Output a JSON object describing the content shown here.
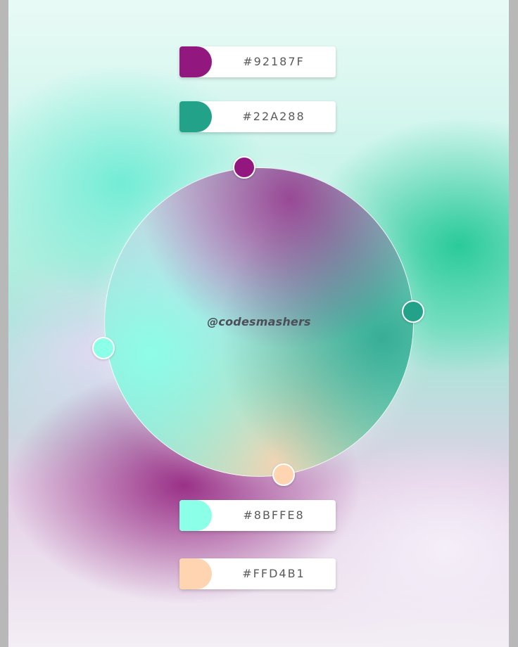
{
  "palette": [
    {
      "hex": "#92187F",
      "color": "#92187F"
    },
    {
      "hex": "#22A288",
      "color": "#22A288"
    },
    {
      "hex": "#8BFFE8",
      "color": "#8BFFE8"
    },
    {
      "hex": "#FFD4B1",
      "color": "#FFD4B1"
    }
  ],
  "watermark": "@codesmashers"
}
